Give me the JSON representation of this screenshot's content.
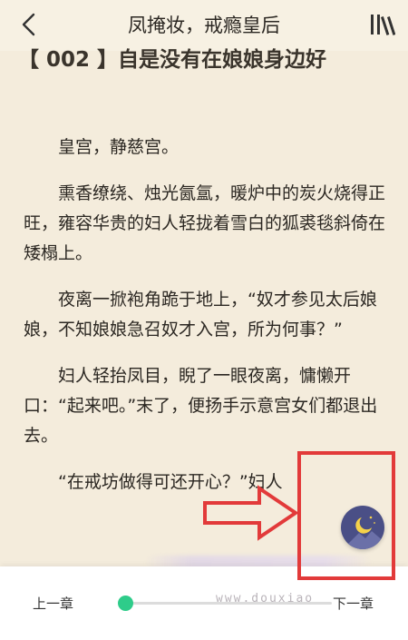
{
  "header": {
    "title": "凤掩妆，戒瘾皇后",
    "back_icon": "back-arrow-icon",
    "menu_icon": "bookshelf-icon"
  },
  "chapter": {
    "title": "【 002 】自是没有在娘娘身边好"
  },
  "paragraphs": [
    "皇宫，静慈宫。",
    "熏香缭绕、烛光氤氲，暖炉中的炭火烧得正旺，雍容华贵的妇人轻拢着雪白的狐裘毯斜倚在矮榻上。",
    "夜离一掀袍角跪于地上，“奴才参见太后娘娘，不知娘娘急召奴才入宫，所为何事？”",
    "妇人轻抬凤目，睨了一眼夜离，慵懒开口：“起来吧。”末了，便扬手示意宫女们都退出去。",
    "“在戒坊做得可还开心？”妇人"
  ],
  "footer": {
    "prev_label": "上一章",
    "next_label": "下一章",
    "progress": 0.03,
    "accent_color": "#2ecc8a"
  },
  "watermark": {
    "text": "www.douxiao"
  },
  "annotation": {
    "color": "#e23a3a"
  },
  "night_mode": {
    "icon": "moon-icon",
    "color": "#4a4f86"
  }
}
